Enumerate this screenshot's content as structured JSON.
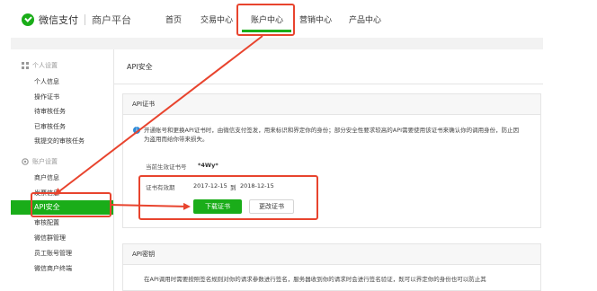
{
  "header": {
    "brand": "微信支付",
    "subbrand": "商户平台",
    "nav": [
      "首页",
      "交易中心",
      "账户中心",
      "营销中心",
      "产品中心"
    ],
    "active_nav": "账户中心"
  },
  "sidebar": {
    "group1": "个人设置",
    "group1_items": [
      "个人信息",
      "操作证书",
      "待审核任务",
      "已审核任务",
      "我提交的审核任务"
    ],
    "group2": "账户设置",
    "group2_items": [
      "商户信息",
      "发票信息",
      "API安全",
      "审核配置",
      "微信群管理",
      "员工账号管理",
      "微信商户终端"
    ],
    "active_item": "API安全"
  },
  "main": {
    "title": "API安全",
    "cert_card_title": "API证书",
    "notice": "开通账号和更换API证书时，由微信支付签发，用来标识和界定你的身份；部分安全性要求较高的API需要使用该证书来确认你的调用身份，防止因为盗用而给你带来损失。",
    "cert_no_label": "当前生效证书号",
    "cert_no_value": "*4Wy*",
    "validity_label": "证书有效期",
    "validity_start": "2017-12-15",
    "validity_to": "到",
    "validity_end": "2018-12-15",
    "download_button": "下载证书",
    "change_button": "更改证书",
    "key_card_title": "API密钥",
    "key_notice": "在API调用时需要按照签名规则对你的请求参数进行签名，服务器收到你的请求时会进行签名验证，既可以界定你的身份也可以防止其"
  },
  "colors": {
    "brand_green": "#1aad19",
    "highlight_red": "#e8442e",
    "info_blue": "#2e8bd8"
  }
}
